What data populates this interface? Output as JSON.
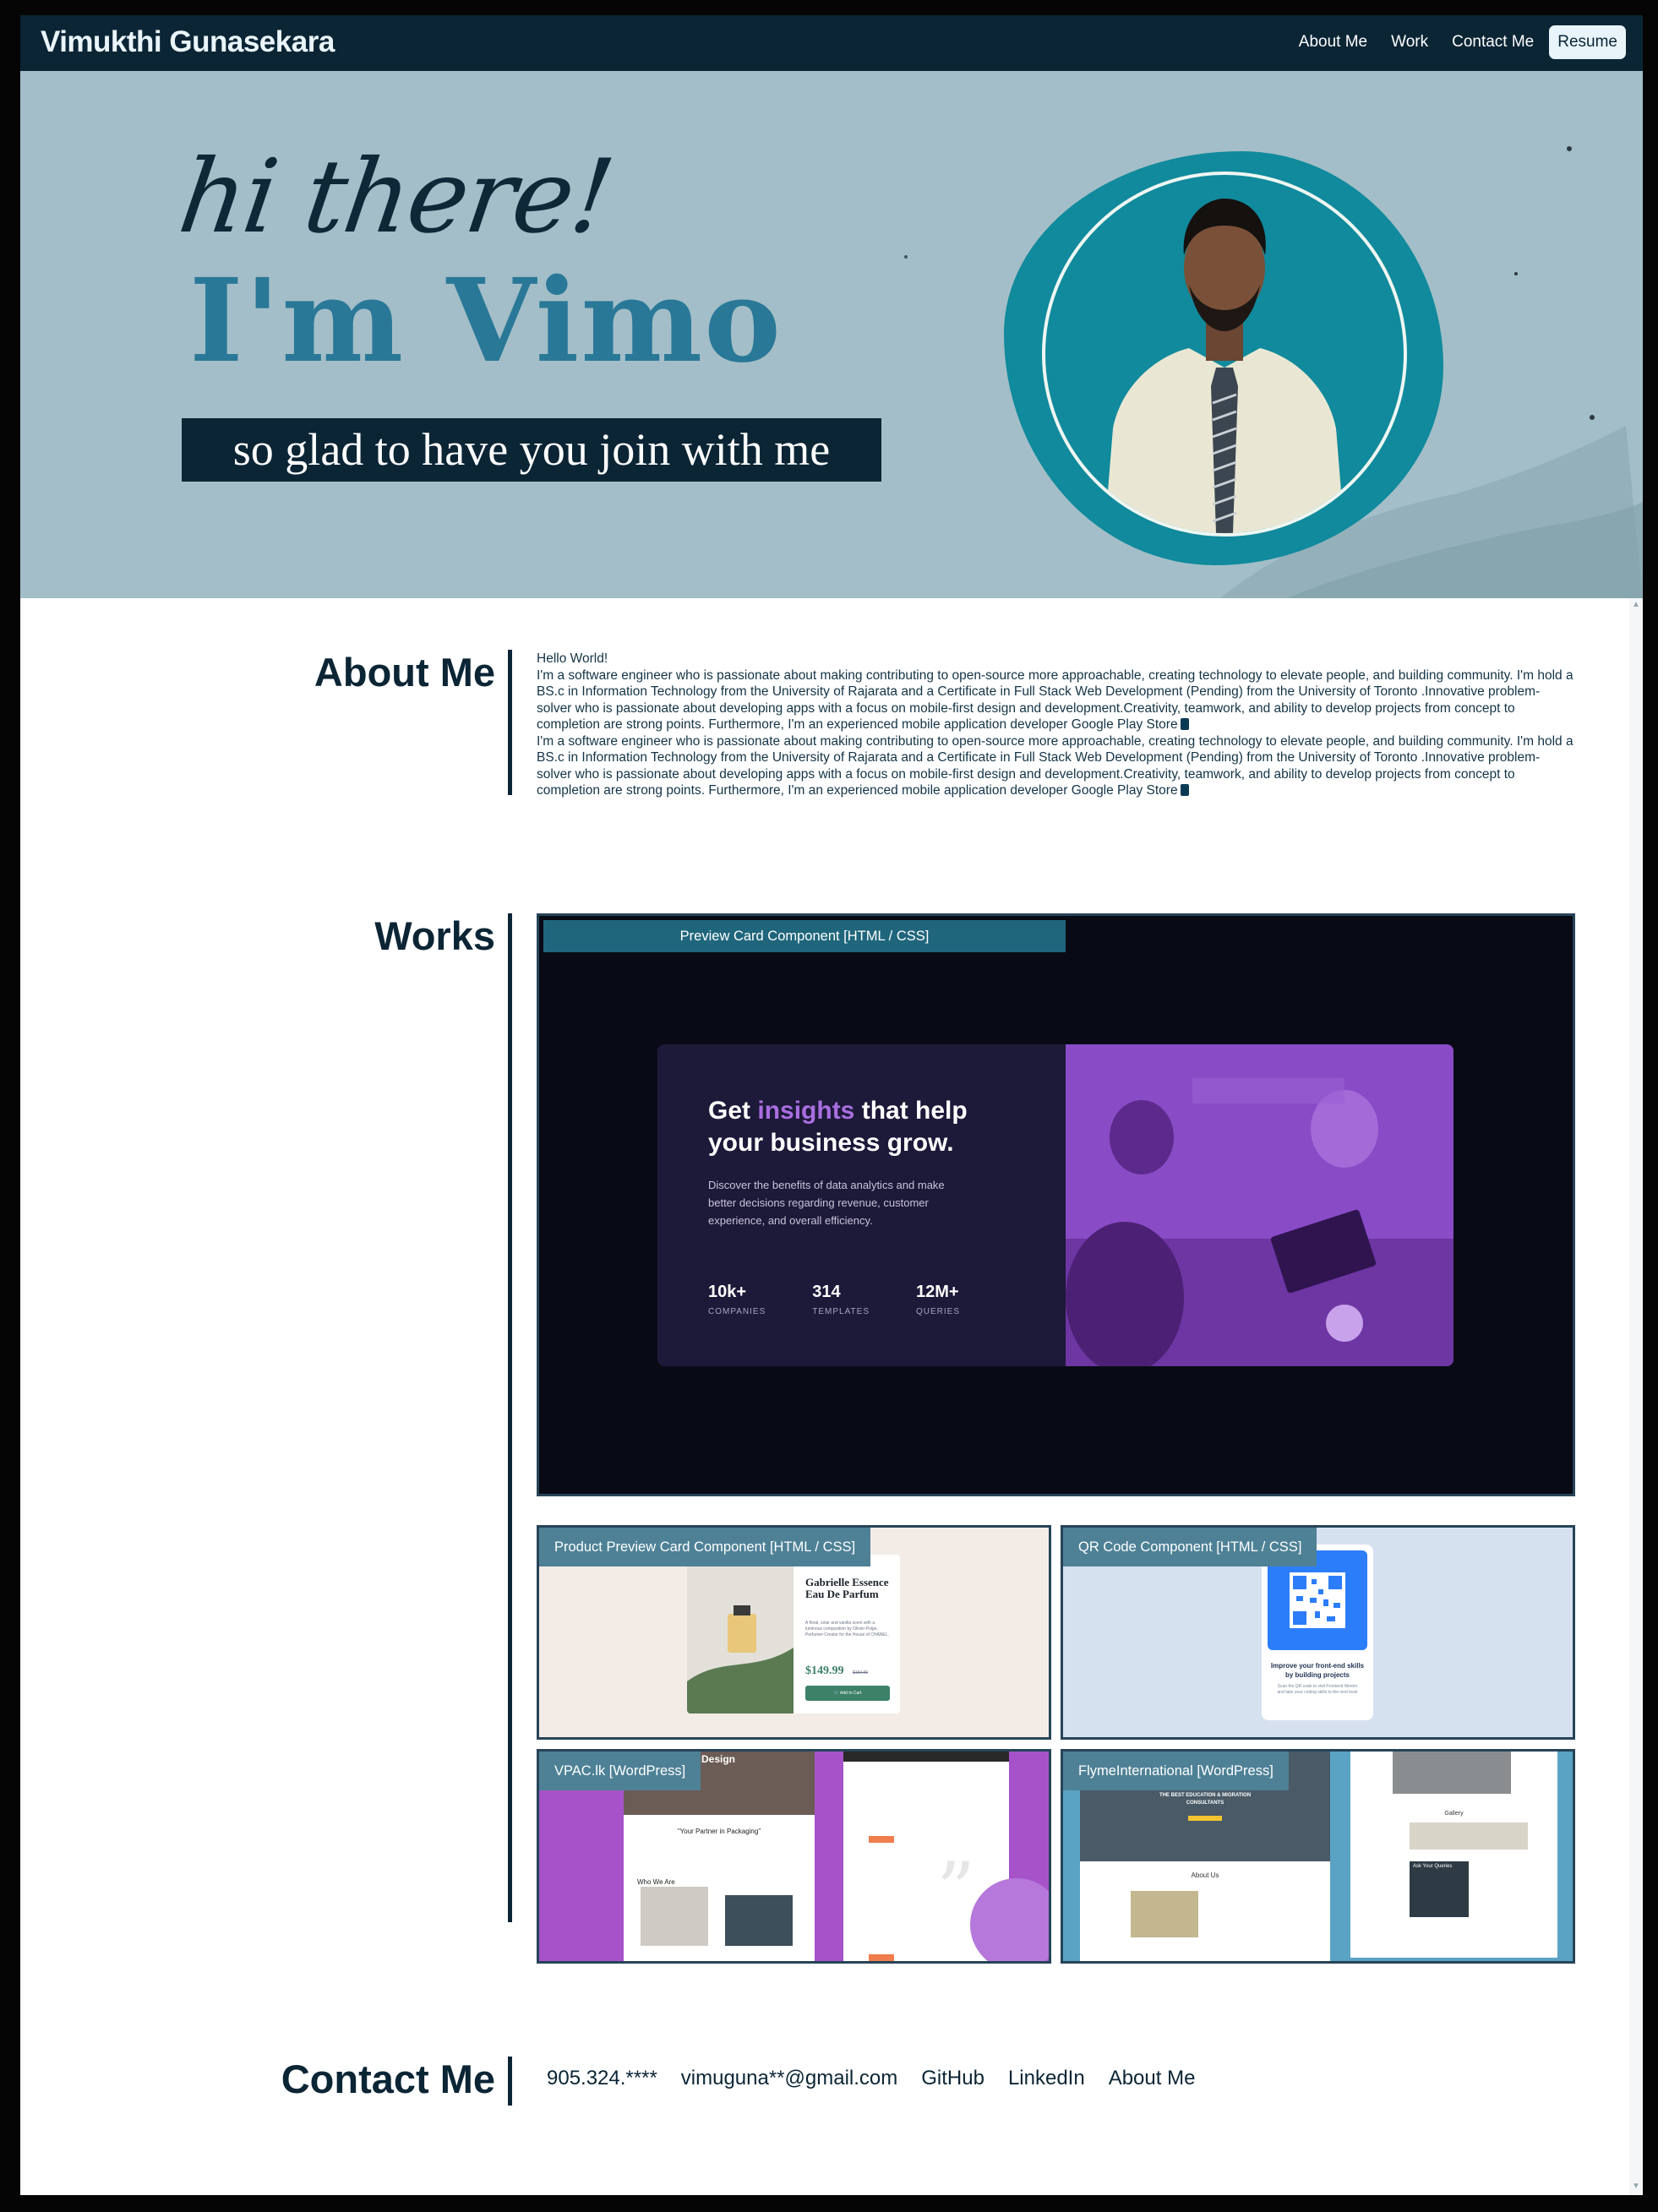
{
  "nav": {
    "brand": "Vimukthi Gunasekara",
    "links": [
      "About Me",
      "Work",
      "Contact Me"
    ],
    "resume": "Resume"
  },
  "hero": {
    "greeting": "hi there!",
    "name": "I'm Vimo",
    "tagline": "so glad to have you join with me"
  },
  "about": {
    "title": "About Me",
    "greeting": "Hello World!",
    "paragraphs": [
      "I'm a software engineer who is passionate about making contributing to open-source more approachable, creating technology to elevate people, and building community. I'm hold a BS.c in Information Technology from the University of Rajarata and a Certificate in Full Stack Web Development (Pending) from the University of Toronto .Innovative problem-solver who is passionate about developing apps with a focus on mobile-first design and development.Creativity, teamwork, and ability to develop projects from concept to completion are strong points. Furthermore, I'm an experienced mobile application developer Google Play Store",
      "I'm a software engineer who is passionate about making contributing to open-source more approachable, creating technology to elevate people, and building community. I'm hold a BS.c in Information Technology from the University of Rajarata and a Certificate in Full Stack Web Development (Pending) from the University of Toronto .Innovative problem-solver who is passionate about developing apps with a focus on mobile-first design and development.Creativity, teamwork, and ability to develop projects from concept to completion are strong points. Furthermore, I'm an experienced mobile application developer Google Play Store"
    ]
  },
  "works": {
    "title": "Works",
    "items": [
      {
        "label": "Preview Card Component [HTML / CSS]",
        "preview": {
          "heading_a": "Get ",
          "heading_b": "insights",
          "heading_c": " that help your business grow.",
          "body": "Discover the benefits of data analytics and make better decisions regarding revenue, customer experience, and overall efficiency.",
          "stats": [
            {
              "value": "10k+",
              "label": "COMPANIES"
            },
            {
              "value": "314",
              "label": "TEMPLATES"
            },
            {
              "value": "12M+",
              "label": "QUERIES"
            }
          ]
        }
      },
      {
        "label": "Product Preview Card Component [HTML / CSS]",
        "preview": {
          "name": "Gabrielle Essence Eau De Parfum",
          "desc": "A floral, solar and vanilla scent with a luminous composition by Olivier Polge, Perfumer-Creator for the House of CHANEL.",
          "price": "$149.99",
          "old_price": "$169.99",
          "button": "Add to Cart"
        }
      },
      {
        "label": "QR Code Component [HTML / CSS]",
        "preview": {
          "title": "Improve your front-end skills by building projects",
          "desc": "Scan the QR code to visit Frontend Mentor and take your coding skills to the next level"
        }
      },
      {
        "label": "VPAC.lk [WordPress]",
        "preview": {
          "banner": "Design",
          "quote": "\"Your Partner in Packaging\"",
          "section": "Who We Are"
        }
      },
      {
        "label": "FlymeInternational [WordPress]",
        "preview": {
          "banner": "THE BEST EDUCATION & MIGRATION CONSULTANTS",
          "about": "About Us",
          "gallery": "Gallery",
          "query": "Ask Your Queries"
        }
      }
    ]
  },
  "contact": {
    "title": "Contact Me",
    "links": [
      "905.324.****",
      "vimuguna**@gmail.com",
      "GitHub",
      "LinkedIn",
      "About Me"
    ]
  },
  "colors": {
    "navy": "#0b2535",
    "teal": "#108a9c",
    "hero_bg": "#a3bec8",
    "card_purple": "#8b4cc7"
  }
}
